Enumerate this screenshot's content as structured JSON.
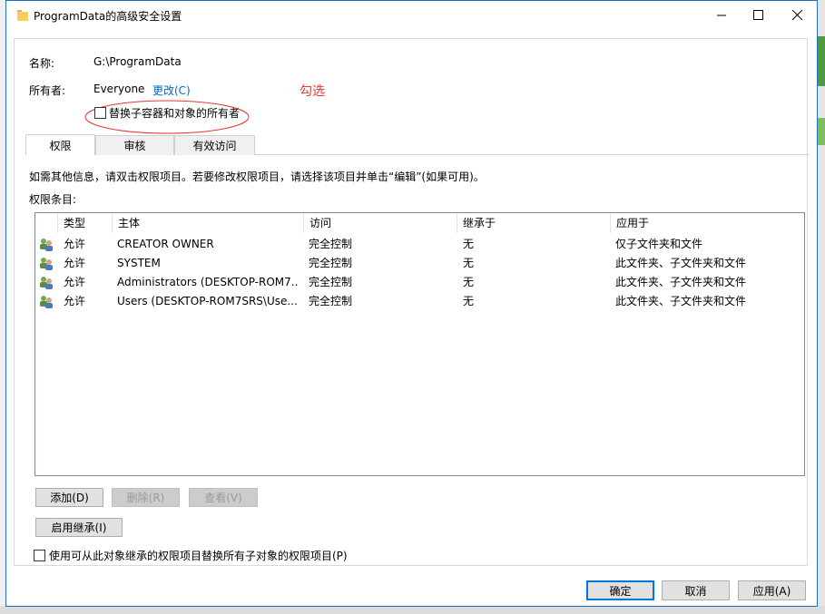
{
  "window": {
    "title": "ProgramData的高级安全设置"
  },
  "info": {
    "name_label": "名称:",
    "name_value": "G:\\ProgramData",
    "owner_label": "所有者:",
    "owner_value": "Everyone",
    "change_link": "更改(C)",
    "replace_owner_checkbox": "替换子容器和对象的所有者",
    "annotation": "勾选"
  },
  "tabs": [
    "权限",
    "审核",
    "有效访问"
  ],
  "instructions": "如需其他信息，请双击权限项目。若要修改权限项目，请选择该项目并单击“编辑”(如果可用)。",
  "entries_label": "权限条目:",
  "table": {
    "columns": [
      "类型",
      "主体",
      "访问",
      "继承于",
      "应用于"
    ],
    "rows": [
      [
        "允许",
        "CREATOR OWNER",
        "完全控制",
        "无",
        "仅子文件夹和文件"
      ],
      [
        "允许",
        "SYSTEM",
        "完全控制",
        "无",
        "此文件夹、子文件夹和文件"
      ],
      [
        "允许",
        "Administrators (DESKTOP-ROM7...",
        "完全控制",
        "无",
        "此文件夹、子文件夹和文件"
      ],
      [
        "允许",
        "Users (DESKTOP-ROM7SRS\\Use...",
        "完全控制",
        "无",
        "此文件夹、子文件夹和文件"
      ]
    ]
  },
  "buttons": {
    "add": "添加(D)",
    "remove": "删除(R)",
    "view": "查看(V)",
    "enable_inheritance": "启用继承(I)",
    "ok": "确定",
    "cancel": "取消",
    "apply": "应用(A)"
  },
  "replace_child_checkbox": "使用可从此对象继承的权限项目替换所有子对象的权限项目(P)",
  "colors": {
    "accent": "#0078d7",
    "link": "#0066cc",
    "annotation": "#e53935"
  }
}
